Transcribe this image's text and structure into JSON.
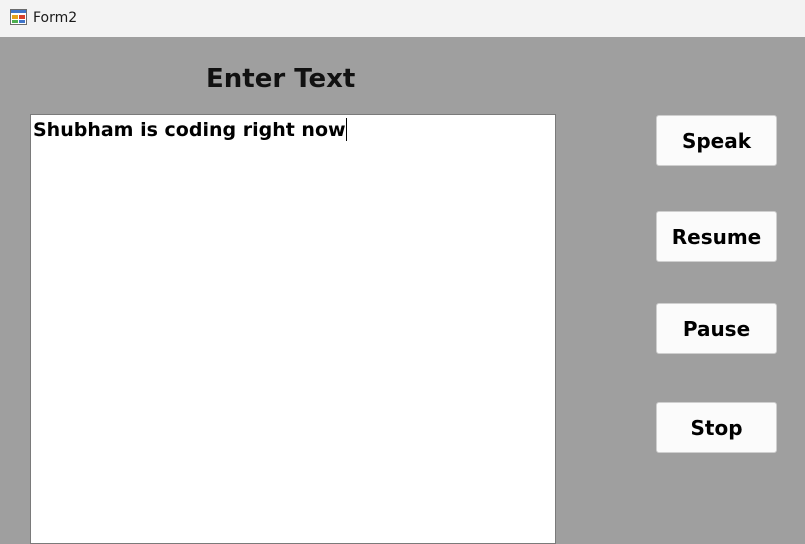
{
  "window": {
    "title": "Form2",
    "icon": "form-app-icon"
  },
  "form": {
    "heading": "Enter Text",
    "textbox_value": "Shubham is coding right now"
  },
  "buttons": {
    "speak": "Speak",
    "resume": "Resume",
    "pause": "Pause",
    "stop": "Stop"
  },
  "colors": {
    "form_background": "#9f9f9f",
    "titlebar_background": "#f3f3f3",
    "textbox_background": "#ffffff",
    "button_background": "#fbfbfb"
  }
}
